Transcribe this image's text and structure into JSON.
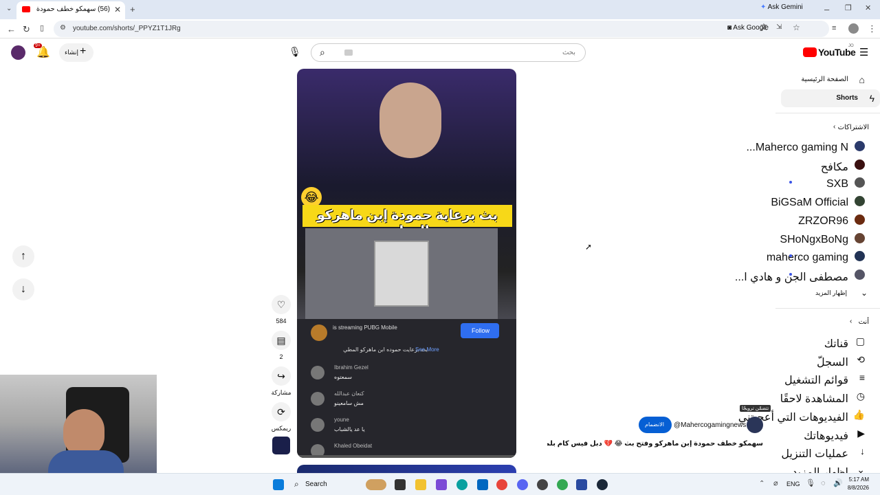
{
  "browser": {
    "tab_title": "(56) سهمكو خطف حمودة إبن ماهركو",
    "url": "youtube.com/shorts/_PPYZ1T1JRg",
    "ask_gemini": "Ask Gemini",
    "ask_google": "Ask Google"
  },
  "header": {
    "brand": "YouTube",
    "brand_region": "JO",
    "search_placeholder": "بحث",
    "create_label": "إنشاء",
    "notification_count": "9+"
  },
  "sidebar": {
    "main": [
      {
        "label": "الصفحة الرئيسية",
        "icon": "home-icon"
      },
      {
        "label": "Shorts",
        "icon": "shorts-icon"
      }
    ],
    "subscriptions_title": "الاشتراكات",
    "subscriptions": [
      {
        "label": "Maherco gaming N...",
        "new": false,
        "avatar_color": "#2b3a6b"
      },
      {
        "label": "مكافح",
        "new": false,
        "avatar_color": "#3a1010"
      },
      {
        "label": "SXB",
        "new": true,
        "avatar_color": "#555555"
      },
      {
        "label": "BiGSaM Official",
        "new": false,
        "avatar_color": "#334433"
      },
      {
        "label": "ZRZOR96",
        "new": false,
        "avatar_color": "#6b2b10"
      },
      {
        "label": "SHoNgxBoNg",
        "new": false,
        "avatar_color": "#664433"
      },
      {
        "label": "maherco gaming",
        "new": true,
        "avatar_color": "#223355"
      },
      {
        "label": "مصطفى الجن و هادي ا...",
        "new": true,
        "avatar_color": "#555566"
      }
    ],
    "show_more": "إظهار المزيد",
    "you_title": "أنت",
    "you_items": [
      {
        "label": "قناتك",
        "icon": "channel-icon"
      },
      {
        "label": "السجلّ",
        "icon": "history-icon"
      },
      {
        "label": "قوائم التشغيل",
        "icon": "playlists-icon"
      },
      {
        "label": "المشاهدة لاحقًا",
        "icon": "watch-later-icon"
      },
      {
        "label": "الفيديوهات التي أعجبتني",
        "icon": "liked-icon"
      },
      {
        "label": "فيديوهاتك",
        "icon": "your-videos-icon"
      },
      {
        "label": "عمليات التنزيل",
        "icon": "downloads-icon"
      },
      {
        "label": "إظهار المزيد",
        "icon": "chevron-down-icon"
      }
    ]
  },
  "video": {
    "banner": "بث برعاية حمودة إبن ماهركو المطي",
    "channel_handle": "@Mahercogamingnews",
    "subscribe_label": "الانضمام",
    "paid_badge": "تتضمّن ترويجًا",
    "title": "سهمكو خطف حمودة إبن ماهركو وفتح بث 😂 💔 دبل فيس كام بلمو ...",
    "overlay": {
      "stream_text": "is streaming PUBG Mobile",
      "follow": "Follow",
      "description": "بث برعايت حموده ابن ماهركو المطي",
      "see_more": "See More",
      "comments": [
        {
          "user": "Ibrahim Gezel",
          "text": "سمعتوه"
        },
        {
          "user": "كنعان عبدالله",
          "text": "مش سامعينو"
        },
        {
          "user": "youne",
          "text": "يا عد يالشباب"
        },
        {
          "user": "Khaled Obeidat",
          "text": ""
        }
      ]
    }
  },
  "actions": {
    "likes": "584",
    "comments": "2",
    "share": "مشاركة",
    "remix": "ريمكس"
  },
  "taskbar": {
    "search": "Search",
    "language": "ENG",
    "time": "5:17 AM",
    "date": "8/8/2026"
  }
}
